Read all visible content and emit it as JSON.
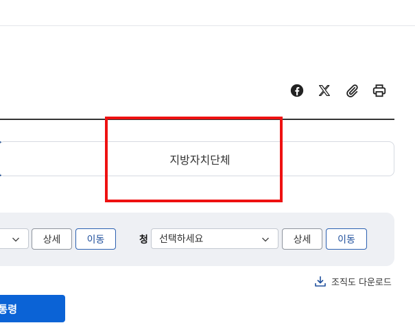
{
  "share": {
    "icons": [
      "facebook-icon",
      "x-icon",
      "clip-icon",
      "print-icon"
    ]
  },
  "tabs": {
    "local_label": "지방자치단체"
  },
  "filters": {
    "right_label": "청",
    "right_placeholder": "선택하세요",
    "detail_label": "상세",
    "move_label": "이동"
  },
  "download": {
    "label": "조직도 다운로드"
  },
  "primary_button": {
    "label": "통령"
  },
  "colors": {
    "accent": "#0b63d6",
    "active_tab": "#0b3f8c",
    "highlight": "#ee1111"
  }
}
